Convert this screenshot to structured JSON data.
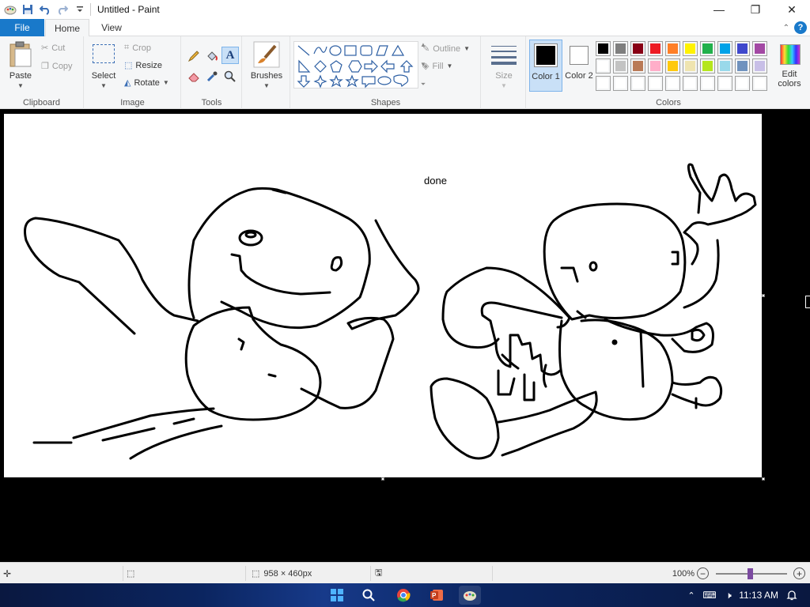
{
  "window": {
    "title": "Untitled - Paint",
    "minimize_glyph": "—",
    "maximize_glyph": "❐",
    "close_glyph": "✕"
  },
  "tabs": {
    "file": "File",
    "home": "Home",
    "view": "View",
    "help_glyph": "?"
  },
  "ribbon": {
    "clipboard": {
      "paste": "Paste",
      "cut": "Cut",
      "copy": "Copy",
      "group": "Clipboard"
    },
    "image": {
      "select": "Select",
      "crop": "Crop",
      "resize": "Resize",
      "rotate": "Rotate",
      "group": "Image"
    },
    "tools": {
      "group": "Tools"
    },
    "brushes": {
      "label": "Brushes"
    },
    "shapes": {
      "outline": "Outline",
      "fill": "Fill",
      "group": "Shapes"
    },
    "size": {
      "label": "Size"
    },
    "colors": {
      "color1_label": "Color 1",
      "color2_label": "Color 2",
      "color1": "#000000",
      "color2": "#ffffff",
      "edit": "Edit colors",
      "group": "Colors",
      "palette_row1": [
        "#000000",
        "#7f7f7f",
        "#880015",
        "#ed1c24",
        "#ff7f27",
        "#fff200",
        "#22b14c",
        "#00a2e8",
        "#3f48cc",
        "#a349a4"
      ],
      "palette_row2": [
        "#ffffff",
        "#c3c3c3",
        "#b97a57",
        "#ffaec9",
        "#ffc90e",
        "#efe4b0",
        "#b5e61d",
        "#99d9ea",
        "#7092be",
        "#c8bfe7"
      ],
      "palette_row3": [
        "#ffffff",
        "#ffffff",
        "#ffffff",
        "#ffffff",
        "#ffffff",
        "#ffffff",
        "#ffffff",
        "#ffffff",
        "#ffffff",
        "#ffffff"
      ]
    }
  },
  "canvas": {
    "text": "done"
  },
  "status": {
    "dimensions": "958 × 460px",
    "zoom": "100%"
  },
  "taskbar": {
    "time": "11:13 AM"
  }
}
